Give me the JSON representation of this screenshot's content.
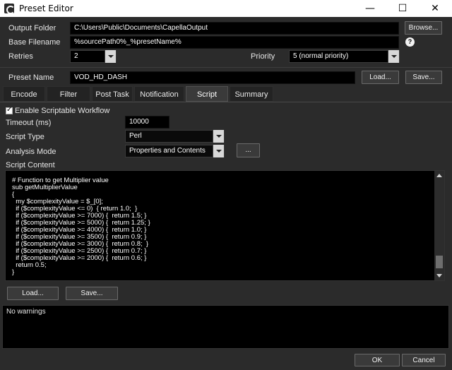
{
  "window": {
    "title": "Preset Editor",
    "controls": {
      "minimize": "—",
      "maximize": "☐",
      "close": "✕"
    }
  },
  "form": {
    "output_folder": {
      "label": "Output Folder",
      "value": "C:\\Users\\Public\\Documents\\CapellaOutput",
      "browse": "Browse..."
    },
    "base_filename": {
      "label": "Base Filename",
      "value": "%sourcePath0%_%presetName%"
    },
    "retries": {
      "label": "Retries",
      "value": "2"
    },
    "priority": {
      "label": "Priority",
      "value": "5 (normal priority)"
    },
    "preset_name": {
      "label": "Preset Name",
      "value": "VOD_HD_DASH",
      "load": "Load...",
      "save": "Save..."
    }
  },
  "tabs": [
    {
      "label": "Encode",
      "active": false
    },
    {
      "label": "Filter",
      "active": false
    },
    {
      "label": "Post Task",
      "active": false
    },
    {
      "label": "Notification",
      "active": false
    },
    {
      "label": "Script",
      "active": true
    },
    {
      "label": "Summary",
      "active": false
    }
  ],
  "script_tab": {
    "enable_label": "Enable Scriptable Workflow",
    "enable_checked": true,
    "timeout": {
      "label": "Timeout (ms)",
      "value": "10000"
    },
    "script_type": {
      "label": "Script Type",
      "value": "Perl"
    },
    "analysis_mode": {
      "label": "Analysis Mode",
      "value": "Properties and Contents",
      "more_button": "..."
    },
    "content_label": "Script Content",
    "code_lines": [
      "# Function to get Multiplier value",
      "sub getMultiplierValue",
      "{",
      "  my $complexityValue = $_[0];",
      "  if ($complexityValue <= 0)  { return 1.0;  }",
      "  if ($complexityValue >= 7000) {  return 1.5; }",
      "  if ($complexityValue >= 5000) {  return 1.25; }",
      "  if ($complexityValue >= 4000) {  return 1.0; }",
      "  if ($complexityValue >= 3500) {  return 0.9; }",
      "  if ($complexityValue >= 3000) {  return 0.8;  }",
      "  if ($complexityValue >= 2500) {  return 0.7; }",
      "  if ($complexityValue >= 2000) {  return 0.6; }",
      "  return 0.5;",
      "}"
    ],
    "load": "Load...",
    "save": "Save..."
  },
  "warnings": "No warnings",
  "footer": {
    "ok": "OK",
    "cancel": "Cancel"
  },
  "icons": {
    "help": "?",
    "app": "app-icon"
  }
}
